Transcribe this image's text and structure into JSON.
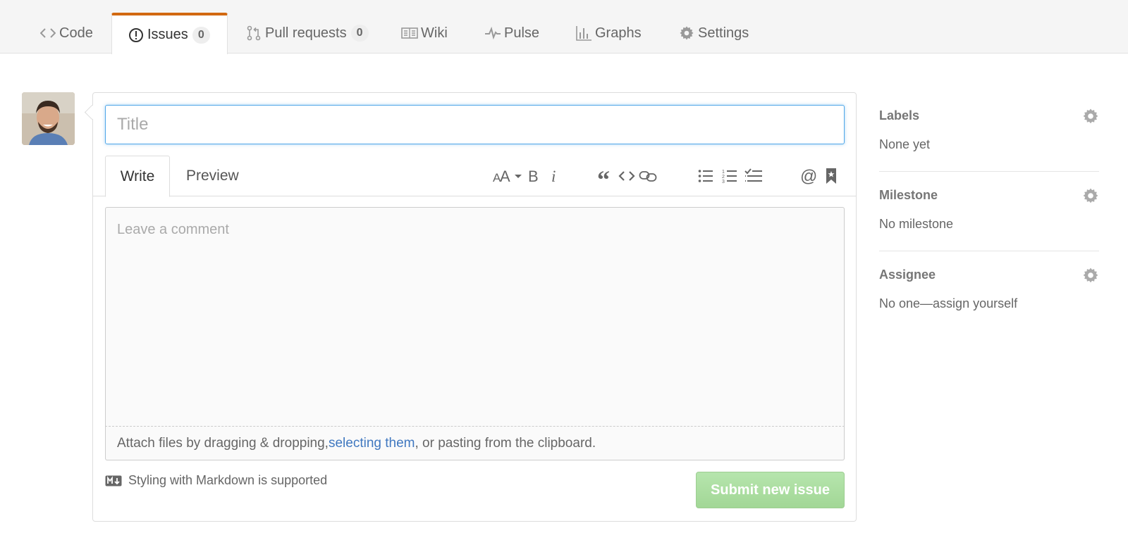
{
  "nav": {
    "tabs": [
      {
        "label": "Code",
        "icon": "code-icon"
      },
      {
        "label": "Issues",
        "icon": "issue-opened-icon",
        "count": "0",
        "selected": true
      },
      {
        "label": "Pull requests",
        "icon": "git-pull-request-icon",
        "count": "0"
      },
      {
        "label": "Wiki",
        "icon": "book-icon"
      },
      {
        "label": "Pulse",
        "icon": "pulse-icon"
      },
      {
        "label": "Graphs",
        "icon": "graph-icon"
      },
      {
        "label": "Settings",
        "icon": "gear-icon"
      }
    ],
    "accent_color": "#d26911"
  },
  "form": {
    "title_placeholder": "Title",
    "tabs": {
      "write": "Write",
      "preview": "Preview"
    },
    "toolbar": [
      "text-size-icon",
      "bold-icon",
      "italic-icon",
      "quote-icon",
      "code-icon",
      "link-icon",
      "unordered-list-icon",
      "ordered-list-icon",
      "task-list-icon",
      "mention-icon",
      "saved-reply-icon"
    ],
    "comment_placeholder": "Leave a comment",
    "attach": {
      "before": "Attach files by dragging & dropping, ",
      "link": "selecting them",
      "after": ", or pasting from the clipboard."
    },
    "markdown_note": "Styling with Markdown is supported",
    "submit_label": "Submit new issue",
    "submit_color": "#a2d796",
    "link_color": "#4078c0"
  },
  "sidebar": {
    "labels": {
      "heading": "Labels",
      "value": "None yet"
    },
    "milestone": {
      "heading": "Milestone",
      "value": "No milestone"
    },
    "assignee": {
      "heading": "Assignee",
      "value": "No one—assign yourself"
    }
  }
}
